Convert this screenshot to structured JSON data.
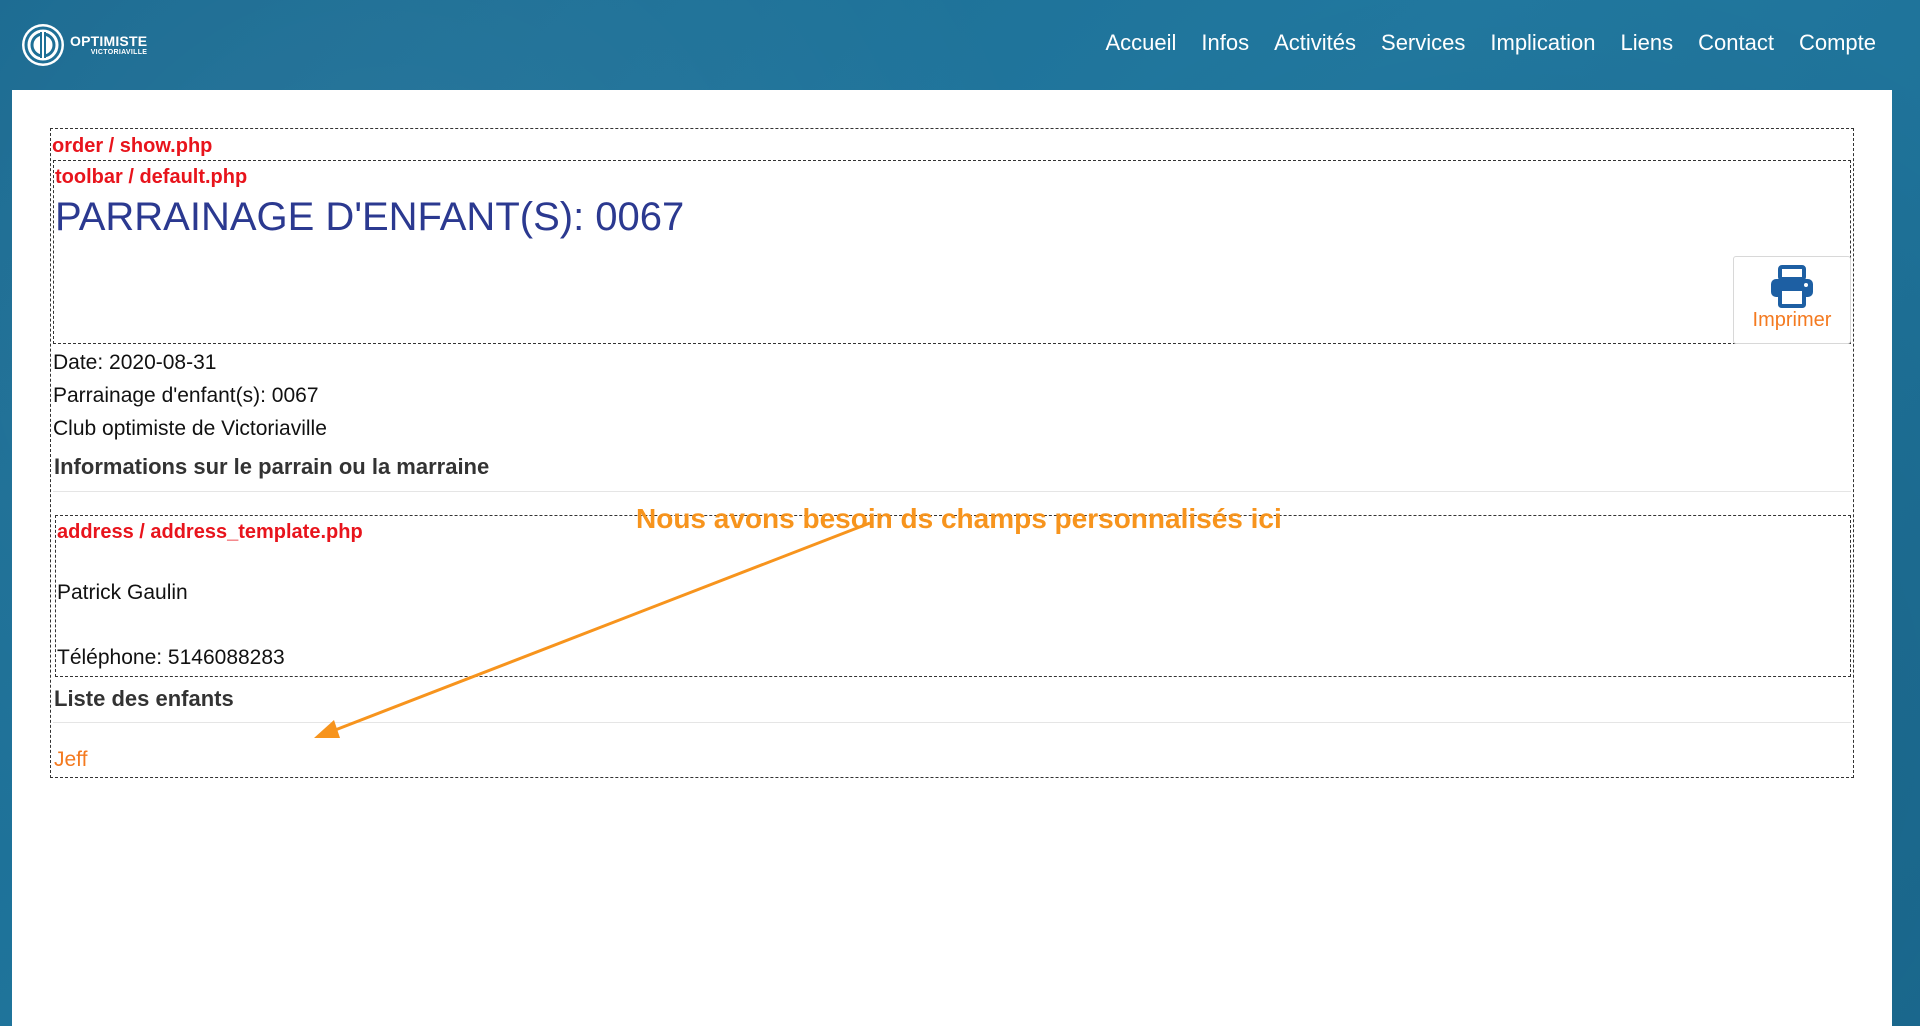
{
  "header": {
    "logo": {
      "title": "OPTIMISTE",
      "subtitle": "VICTORIAVILLE"
    },
    "nav": [
      "Accueil",
      "Infos",
      "Activités",
      "Services",
      "Implication",
      "Liens",
      "Contact",
      "Compte"
    ]
  },
  "debug": {
    "order_template": "order / show.php",
    "toolbar_template": "toolbar / default.php",
    "address_template": "address / address_template.php"
  },
  "page": {
    "title": "PARRAINAGE D'ENFANT(S): 0067",
    "print_label": "Imprimer",
    "date_line": "Date: 2020-08-31",
    "order_line": "Parrainage d'enfant(s): 0067",
    "club_line": "Club optimiste de Victoriaville",
    "sponsor_heading": "Informations sur le parrain ou la marraine",
    "sponsor_name": "Patrick Gaulin",
    "sponsor_phone": "Téléphone: 5146088283",
    "children_heading": "Liste des enfants",
    "children": [
      "Jeff"
    ]
  },
  "annotation": {
    "text": "Nous avons besoin ds champs personnalisés ici",
    "color": "#f7941d"
  },
  "colors": {
    "header_bg": "#1e6f96",
    "title_blue": "#2b3990",
    "debug_red": "#e8141c",
    "accent_orange": "#f47a20",
    "print_icon": "#1d5fa3"
  }
}
